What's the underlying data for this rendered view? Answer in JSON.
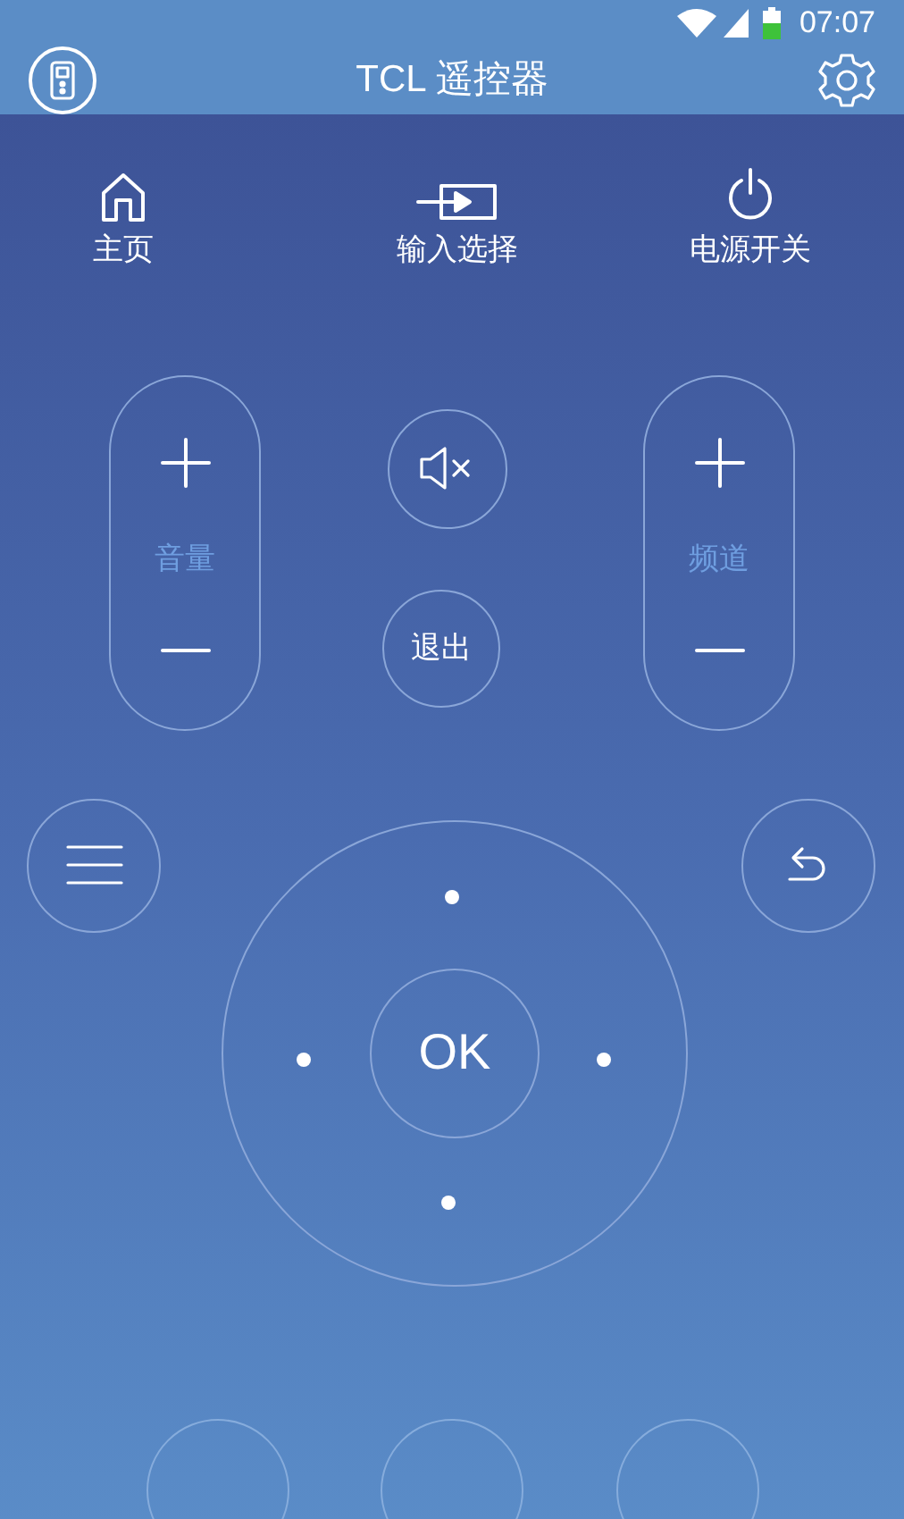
{
  "status_bar": {
    "time": "07:07"
  },
  "header": {
    "title": "TCL 遥控器"
  },
  "quick_actions": [
    {
      "label": "主页",
      "kind": "home"
    },
    {
      "label": "输入选择",
      "kind": "input"
    },
    {
      "label": "电源开关",
      "kind": "power"
    }
  ],
  "rockers": [
    {
      "label": "音量"
    },
    {
      "label": "频道"
    }
  ],
  "exit_button": {
    "label": "退出"
  },
  "dpad": {
    "ok_label": "OK"
  }
}
